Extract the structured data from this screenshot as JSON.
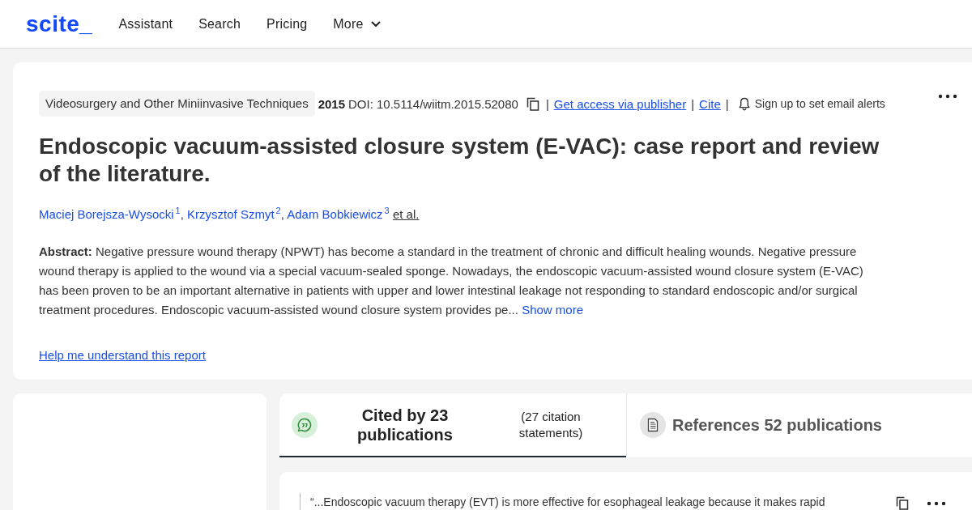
{
  "header": {
    "logo": "scite_",
    "nav": [
      {
        "label": "Assistant",
        "dropdown": false
      },
      {
        "label": "Search",
        "dropdown": false
      },
      {
        "label": "Pricing",
        "dropdown": false
      },
      {
        "label": "More",
        "dropdown": true
      }
    ]
  },
  "paper": {
    "meta": [
      {
        "kind": "journal",
        "text": "Videosurgery and Other Miniinvasive Techniques"
      },
      {
        "kind": "year",
        "text": "2015"
      },
      {
        "kind": "doi",
        "text": "DOI: 10.5114/wiitm.2015.52080"
      },
      {
        "kind": "copy"
      },
      {
        "kind": "separator",
        "text": "|"
      },
      {
        "kind": "access",
        "text": "Get access via publisher"
      },
      {
        "kind": "separator",
        "text": "|"
      },
      {
        "kind": "cite",
        "text": "Cite"
      },
      {
        "kind": "separator",
        "text": "|"
      },
      {
        "kind": "alert",
        "text": "Sign up to set email alerts"
      }
    ],
    "title": "Endoscopic vacuum-assisted closure system (E-VAC): case report and review of the literature.",
    "authors": [
      {
        "name": "Maciej Borejsza-Wysocki",
        "affiliation": "1",
        "separator": ","
      },
      {
        "name": "Krzysztof Szmyt",
        "affiliation": "2",
        "separator": ","
      },
      {
        "name": "Adam Bobkiewicz",
        "affiliation": "3"
      }
    ],
    "et_al": "et al.",
    "abstract": {
      "text": "**Abstract:** Negative pressure wound therapy (NPWT) has become a standard in the treatment of chronic and difficult healing wounds. Negative pressure wound therapy is applied to the wound via a special vacuum-sealed sponge. Nowadays, the endoscopic vacuum-assisted wound closure system (E-VAC) has been proven to be an important alternative in patients with upper and lower intestinal leakage not responding to standard endoscopic and/or surgical treatment procedures. Endoscopic vacuum-assisted wound closure system provides pe...",
      "more": "Show more"
    },
    "help_link": "Help me understand this report"
  },
  "tabs": [
    {
      "kind": "cited_by",
      "label": "Cited by 23 publications",
      "note": "(27 citation statements)",
      "selected": true
    },
    {
      "kind": "references",
      "label": "References 52 publications",
      "selected": false
    }
  ],
  "citations": [
    {
      "quote": "“...Endoscopic vacuum therapy (EVT) is more effective for esophageal leakage because it makes rapid"
    }
  ]
}
